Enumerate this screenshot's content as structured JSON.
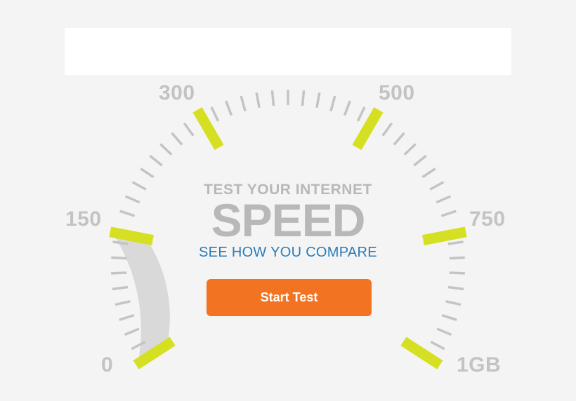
{
  "header": {
    "banner": ""
  },
  "gauge": {
    "scale_labels": [
      "0",
      "150",
      "300",
      "500",
      "750",
      "1GB"
    ],
    "needle_value": "",
    "colors": {
      "tick": "#c4c4c4",
      "major_tick": "#d6e022",
      "filled_band": "#d9d9d9",
      "label": "#c3c3c3"
    }
  },
  "main": {
    "headline_small": "TEST YOUR INTERNET",
    "headline_big": "SPEED",
    "subline": "SEE HOW YOU COMPARE",
    "start_button_label": "Start Test"
  },
  "colors": {
    "accent": "#f27321",
    "link_blue": "#2a7db6",
    "background": "#f4f4f4"
  }
}
